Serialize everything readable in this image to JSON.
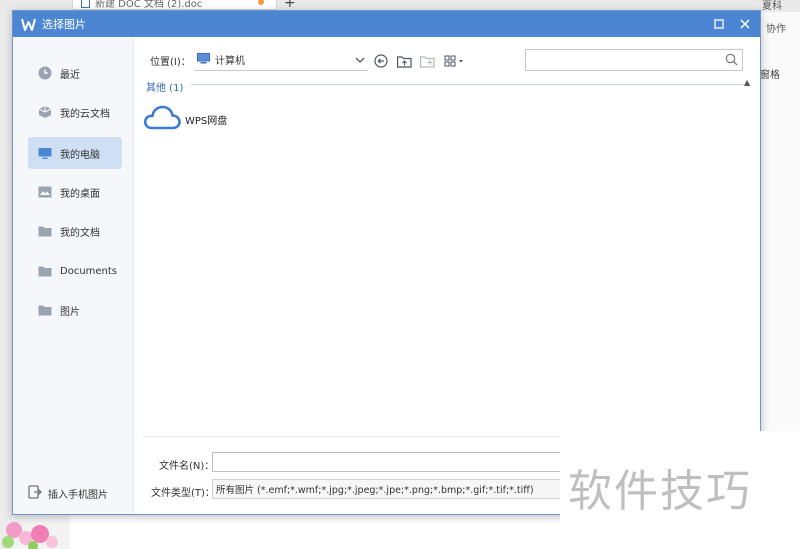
{
  "background": {
    "doc_tab_title": "新建 DOC 文档 (2).doc",
    "right_top_label": "夏科",
    "right_collab_label": "协作",
    "right_side_label": "窗格"
  },
  "dialog": {
    "title": "选择图片",
    "sidebar": {
      "items": [
        {
          "label": "最近",
          "icon": "clock-icon"
        },
        {
          "label": "我的云文档",
          "icon": "cloud-doc-icon"
        },
        {
          "label": "我的电脑",
          "icon": "monitor-icon"
        },
        {
          "label": "我的桌面",
          "icon": "desktop-icon"
        },
        {
          "label": "我的文档",
          "icon": "folder-icon"
        },
        {
          "label": "Documents",
          "icon": "folder-icon"
        },
        {
          "label": "图片",
          "icon": "folder-icon"
        }
      ],
      "active_index": 2,
      "insert_phone_label": "插入手机图片"
    },
    "toolbar": {
      "location_label": "位置(I)：",
      "location_value": "计算机",
      "search_placeholder": ""
    },
    "content": {
      "group_label": "其他 (1)",
      "items": [
        {
          "label": "WPS网盘",
          "icon": "cloud-drive-icon"
        }
      ]
    },
    "form": {
      "filename_label": "文件名(N)：",
      "filename_value": "",
      "filetype_label": "文件类型(T)：",
      "filetype_value": "所有图片 (*.emf;*.wmf;*.jpg;*.jpeg;*.jpe;*.png;*.bmp;*.gif;*.tif;*.tiff)"
    }
  },
  "watermark": "软件技巧",
  "colors": {
    "titlebar": "#4c86d3",
    "sidebar_active": "#cfe0f5",
    "group_label": "#2f6ac0"
  }
}
